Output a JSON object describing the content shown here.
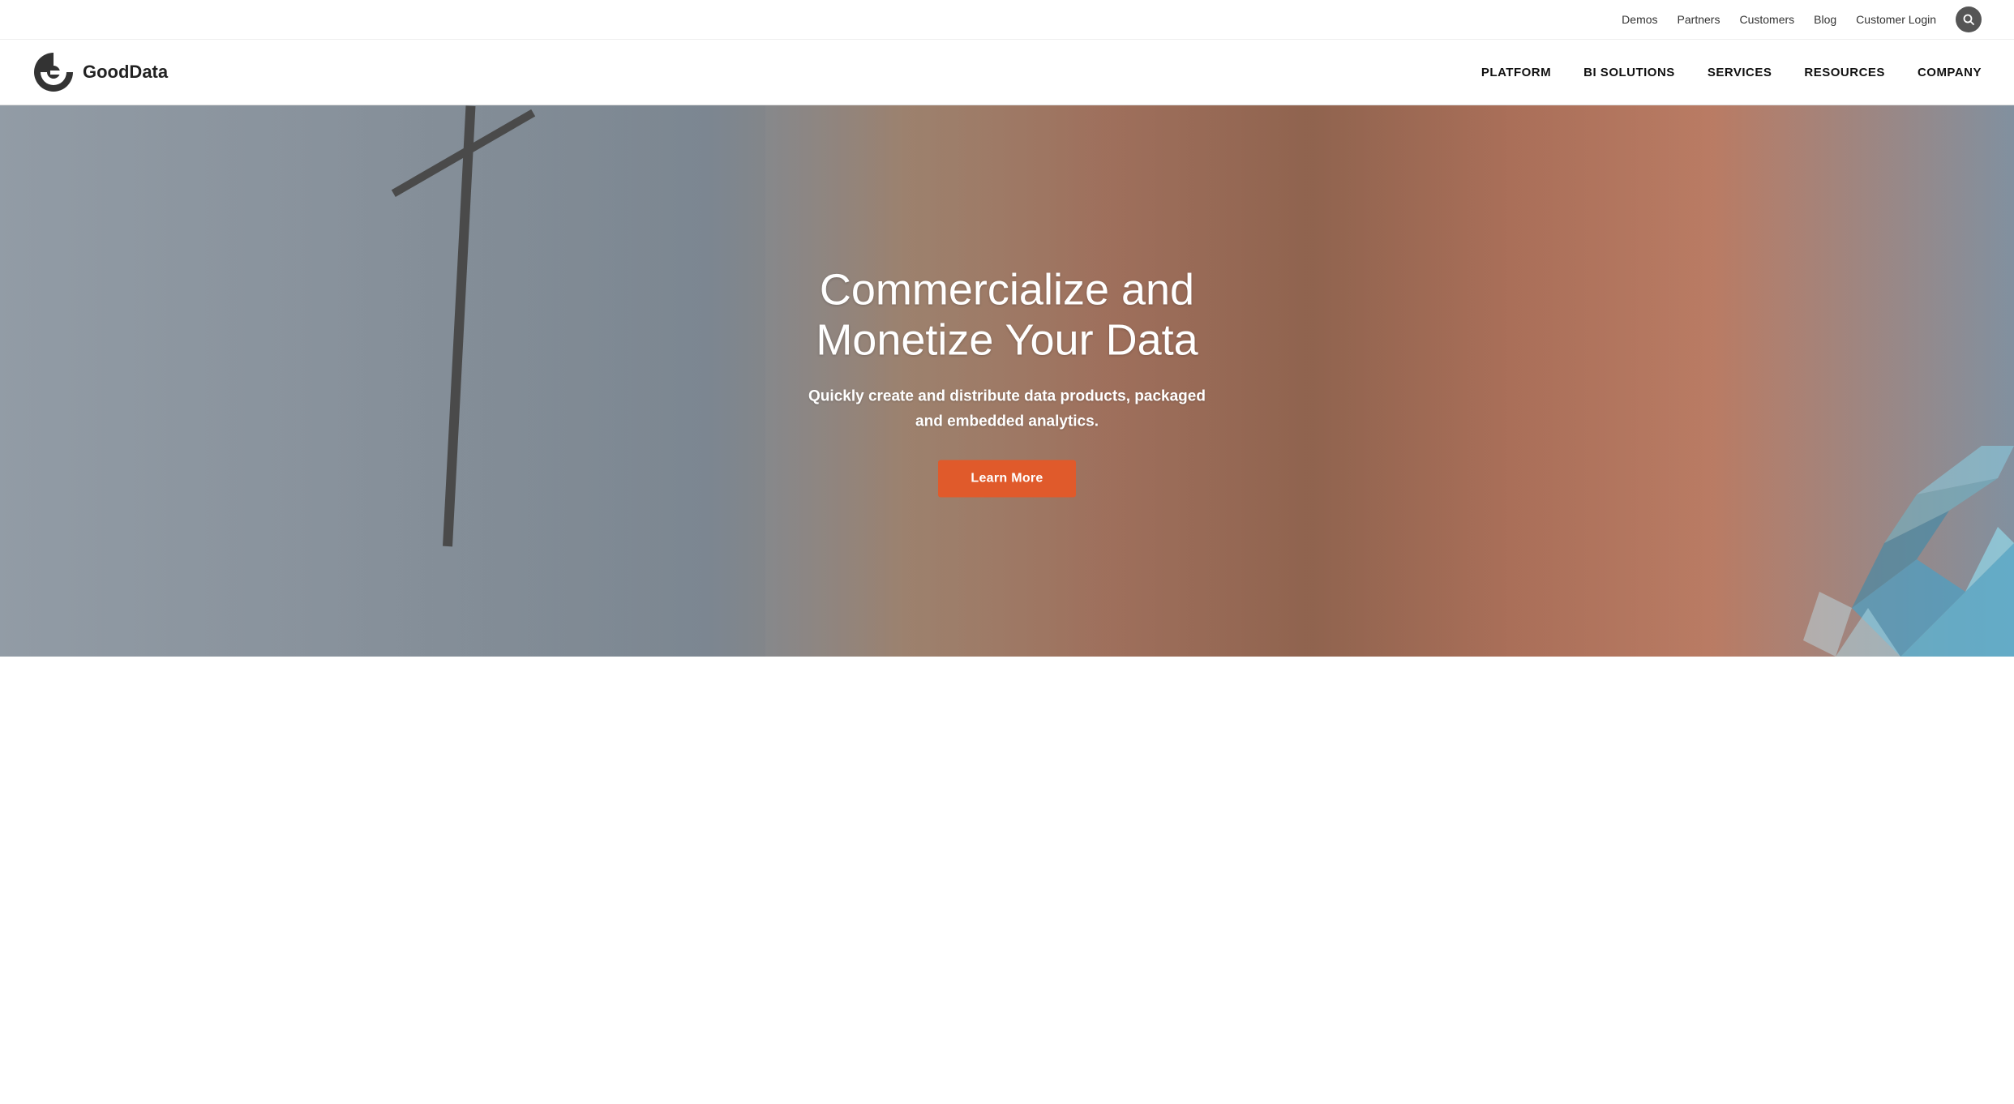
{
  "topBar": {
    "links": [
      {
        "label": "Demos",
        "id": "demos"
      },
      {
        "label": "Partners",
        "id": "partners"
      },
      {
        "label": "Customers",
        "id": "customers"
      },
      {
        "label": "Blog",
        "id": "blog"
      },
      {
        "label": "Customer Login",
        "id": "customer-login"
      }
    ],
    "searchIcon": "🔍"
  },
  "mainNav": {
    "logoText": "GoodData",
    "navLinks": [
      {
        "label": "PLATFORM",
        "id": "platform"
      },
      {
        "label": "BI SOLUTIONS",
        "id": "bi-solutions"
      },
      {
        "label": "SERVICES",
        "id": "services"
      },
      {
        "label": "RESOURCES",
        "id": "resources"
      },
      {
        "label": "COMPANY",
        "id": "company"
      }
    ]
  },
  "hero": {
    "headline": "Commercialize and Monetize Your Data",
    "subtext": "Quickly create and distribute data products, packaged and embedded analytics.",
    "ctaLabel": "Learn More",
    "ctaUrl": "#"
  }
}
